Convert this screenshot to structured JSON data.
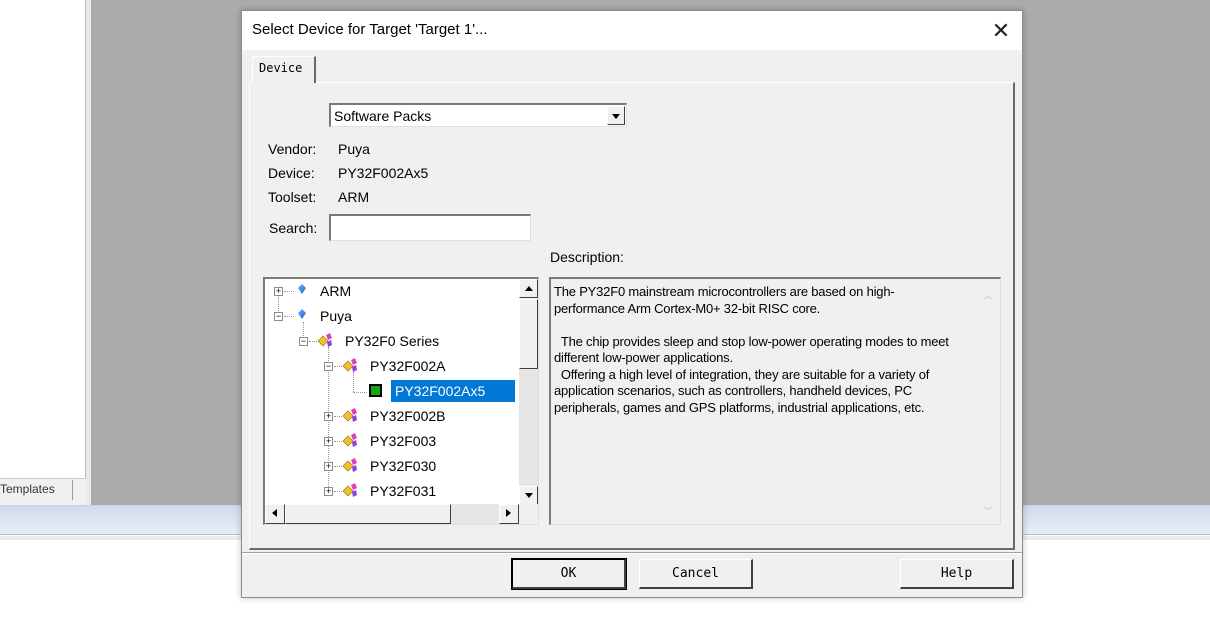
{
  "background": {
    "templates_tab_label": "Templates"
  },
  "dialog": {
    "title": "Select Device for Target 'Target 1'...",
    "close_icon": "close-icon",
    "tab_label": "Device",
    "pack_source": {
      "selected": "Software Packs"
    },
    "info": {
      "vendor_label": "Vendor:",
      "vendor_value": "Puya",
      "device_label": "Device:",
      "device_value": "PY32F002Ax5",
      "toolset_label": "Toolset:",
      "toolset_value": "ARM"
    },
    "search": {
      "label": "Search:",
      "value": ""
    },
    "tree": {
      "items": [
        {
          "label": "ARM",
          "expander": "+",
          "icon": "vendor-gem-icon"
        },
        {
          "label": "Puya",
          "expander": "−",
          "icon": "vendor-gem-icon"
        },
        {
          "label": "PY32F0 Series",
          "expander": "−",
          "icon": "series-icon"
        },
        {
          "label": "PY32F002A",
          "expander": "−",
          "icon": "series-icon"
        },
        {
          "label": "PY32F002Ax5",
          "expander": "",
          "icon": "chip-icon",
          "selected": true
        },
        {
          "label": "PY32F002B",
          "expander": "+",
          "icon": "series-icon"
        },
        {
          "label": "PY32F003",
          "expander": "+",
          "icon": "series-icon"
        },
        {
          "label": "PY32F030",
          "expander": "+",
          "icon": "series-icon"
        },
        {
          "label": "PY32F031",
          "expander": "+",
          "icon": "series-icon"
        }
      ]
    },
    "description": {
      "label": "Description:",
      "text": "The PY32F0 mainstream microcontrollers are based on high-\nperformance Arm Cortex-M0+ 32-bit RISC core.\n\n  The chip provides sleep and stop low-power operating modes to meet\ndifferent low-power applications.\n  Offering a high level of integration, they are suitable for a variety of\napplication scenarios, such as controllers, handheld devices, PC\nperipherals, games and GPS platforms, industrial applications, etc."
    },
    "buttons": {
      "ok": "OK",
      "cancel": "Cancel",
      "help": "Help"
    },
    "colors": {
      "selection": "#0078d7",
      "chip": "#10a910"
    }
  }
}
